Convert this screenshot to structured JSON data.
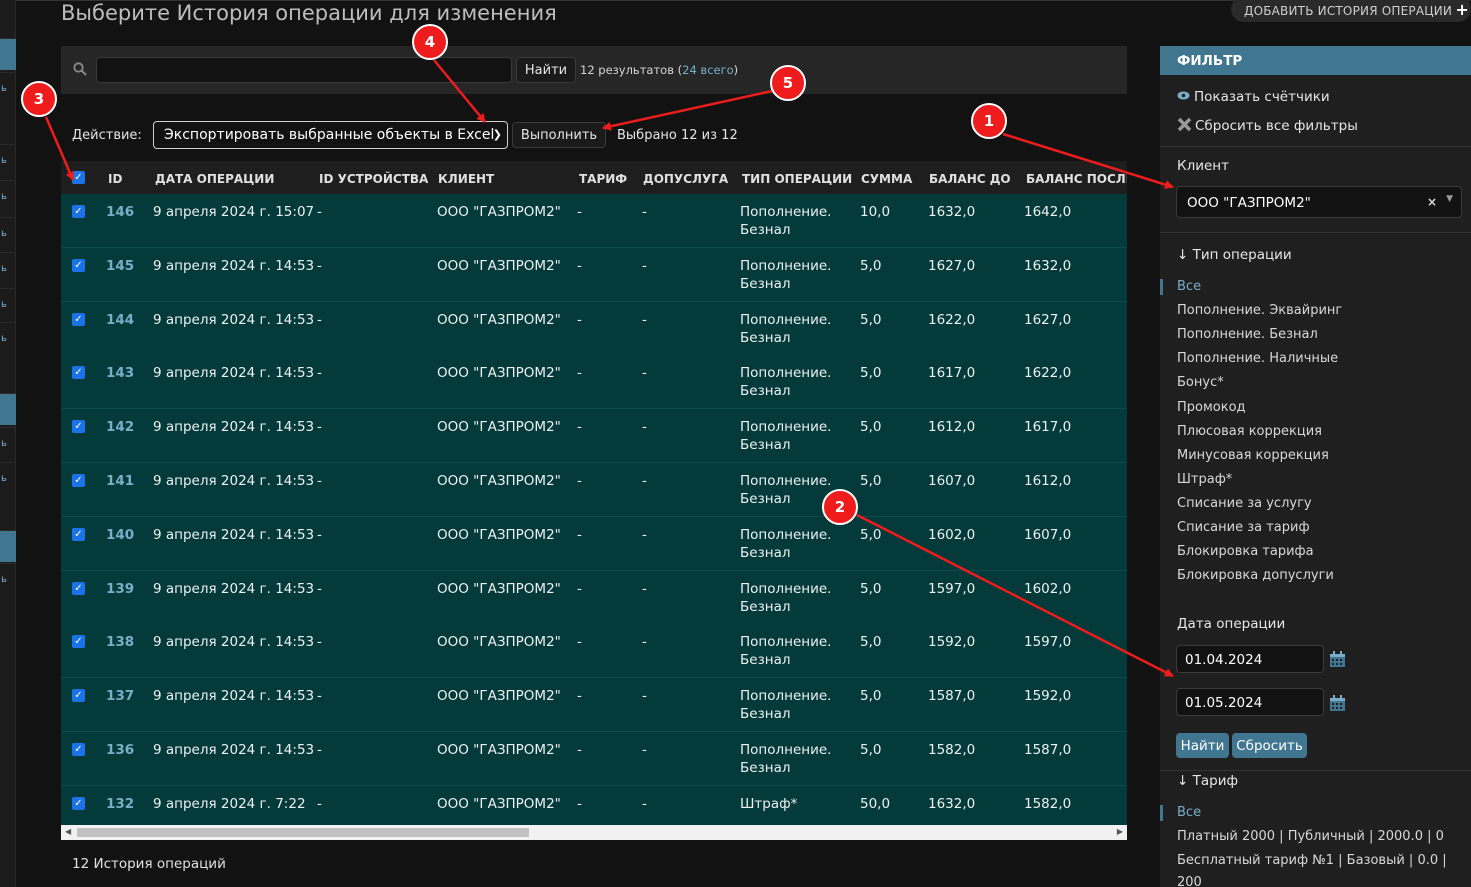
{
  "left_strip": {
    "items": [
      "ь",
      "ь",
      "ь",
      "ь",
      "ь",
      "ь",
      "ь",
      "ь",
      "ь",
      "ь",
      "ь"
    ]
  },
  "page_title": "Выберите История операции для изменения",
  "add_button": {
    "label": "ДОБАВИТЬ ИСТОРИЯ ОПЕРАЦИИ",
    "icon": "plus-icon"
  },
  "search": {
    "value": "",
    "placeholder": "",
    "button_label": "Найти",
    "results_text": "12 результатов (",
    "total_link": "24 всего",
    "results_close": ")"
  },
  "actions": {
    "label": "Действие:",
    "selected": "Экспортировать выбранные объекты в Excel",
    "run_label": "Выполнить",
    "selected_count": "Выбрано 12 из 12"
  },
  "table": {
    "columns": [
      "ID",
      "ДАТА ОПЕРАЦИИ",
      "ID УСТРОЙСТВА",
      "КЛИЕНТ",
      "ТАРИФ",
      "ДОПУСЛУГА",
      "ТИП ОПЕРАЦИИ",
      "СУММА",
      "БАЛАНС ДО",
      "БАЛАНС ПОСЛЕ"
    ],
    "rows": [
      {
        "id": "146",
        "date": "9 апреля 2024 г. 15:07",
        "device": "-",
        "client": "ООО \"ГАЗПРОМ2\"",
        "tariff": "-",
        "service": "-",
        "type": "Пополнение. Безнал",
        "sum": "10,0",
        "before": "1632,0",
        "after": "1642,0"
      },
      {
        "id": "145",
        "date": "9 апреля 2024 г. 14:53",
        "device": "-",
        "client": "ООО \"ГАЗПРОМ2\"",
        "tariff": "-",
        "service": "-",
        "type": "Пополнение. Безнал",
        "sum": "5,0",
        "before": "1627,0",
        "after": "1632,0"
      },
      {
        "id": "144",
        "date": "9 апреля 2024 г. 14:53",
        "device": "-",
        "client": "ООО \"ГАЗПРОМ2\"",
        "tariff": "-",
        "service": "-",
        "type": "Пополнение. Безнал",
        "sum": "5,0",
        "before": "1622,0",
        "after": "1627,0"
      },
      {
        "id": "143",
        "date": "9 апреля 2024 г. 14:53",
        "device": "-",
        "client": "ООО \"ГАЗПРОМ2\"",
        "tariff": "-",
        "service": "-",
        "type": "Пополнение. Безнал",
        "sum": "5,0",
        "before": "1617,0",
        "after": "1622,0"
      },
      {
        "id": "142",
        "date": "9 апреля 2024 г. 14:53",
        "device": "-",
        "client": "ООО \"ГАЗПРОМ2\"",
        "tariff": "-",
        "service": "-",
        "type": "Пополнение. Безнал",
        "sum": "5,0",
        "before": "1612,0",
        "after": "1617,0"
      },
      {
        "id": "141",
        "date": "9 апреля 2024 г. 14:53",
        "device": "-",
        "client": "ООО \"ГАЗПРОМ2\"",
        "tariff": "-",
        "service": "-",
        "type": "Пополнение. Безнал",
        "sum": "5,0",
        "before": "1607,0",
        "after": "1612,0"
      },
      {
        "id": "140",
        "date": "9 апреля 2024 г. 14:53",
        "device": "-",
        "client": "ООО \"ГАЗПРОМ2\"",
        "tariff": "-",
        "service": "-",
        "type": "Пополнение. Безнал",
        "sum": "5,0",
        "before": "1602,0",
        "after": "1607,0"
      },
      {
        "id": "139",
        "date": "9 апреля 2024 г. 14:53",
        "device": "-",
        "client": "ООО \"ГАЗПРОМ2\"",
        "tariff": "-",
        "service": "-",
        "type": "Пополнение. Безнал",
        "sum": "5,0",
        "before": "1597,0",
        "after": "1602,0"
      },
      {
        "id": "138",
        "date": "9 апреля 2024 г. 14:53",
        "device": "-",
        "client": "ООО \"ГАЗПРОМ2\"",
        "tariff": "-",
        "service": "-",
        "type": "Пополнение. Безнал",
        "sum": "5,0",
        "before": "1592,0",
        "after": "1597,0"
      },
      {
        "id": "137",
        "date": "9 апреля 2024 г. 14:53",
        "device": "-",
        "client": "ООО \"ГАЗПРОМ2\"",
        "tariff": "-",
        "service": "-",
        "type": "Пополнение. Безнал",
        "sum": "5,0",
        "before": "1587,0",
        "after": "1592,0"
      },
      {
        "id": "136",
        "date": "9 апреля 2024 г. 14:53",
        "device": "-",
        "client": "ООО \"ГАЗПРОМ2\"",
        "tariff": "-",
        "service": "-",
        "type": "Пополнение. Безнал",
        "sum": "5,0",
        "before": "1582,0",
        "after": "1587,0"
      },
      {
        "id": "132",
        "date": "9 апреля 2024 г. 7:22",
        "device": "-",
        "client": "ООО \"ГАЗПРОМ2\"",
        "tariff": "-",
        "service": "-",
        "type": "Штраф*",
        "sum": "50,0",
        "before": "1632,0",
        "after": "1582,0"
      }
    ]
  },
  "paginator": "12 История операций",
  "filter": {
    "title": "ФИЛЬТР",
    "show_counts": "Показать счётчики",
    "reset_all": "Сбросить все фильтры",
    "client_label": "Клиент",
    "client_value": "ООО \"ГАЗПРОМ2\"",
    "optype_label": "↓ Тип операции",
    "optype_items": [
      "Все",
      "Пополнение. Эквайринг",
      "Пополнение. Безнал",
      "Пополнение. Наличные",
      "Бонус*",
      "Промокод",
      "Плюсовая коррекция",
      "Минусовая коррекция",
      "Штраф*",
      "Списание за услугу",
      "Списание за тариф",
      "Блокировка тарифа",
      "Блокировка допуслуги"
    ],
    "date_label": "Дата операции",
    "date_from": "01.04.2024",
    "date_to": "01.05.2024",
    "search_label": "Найти",
    "reset_label": "Сбросить",
    "tariff_label": "↓ Тариф",
    "tariff_items": [
      "Все",
      "Платный 2000 | Публичный | 2000.0 | 0",
      "Бесплатный тариф №1 | Базовый | 0.0 |",
      "200"
    ]
  },
  "annotations": [
    "1",
    "2",
    "3",
    "4",
    "5"
  ],
  "colors": {
    "accent": "#417690",
    "row_bg": "#053a3a",
    "link": "#79aec8",
    "marker": "#ee1c1c"
  }
}
